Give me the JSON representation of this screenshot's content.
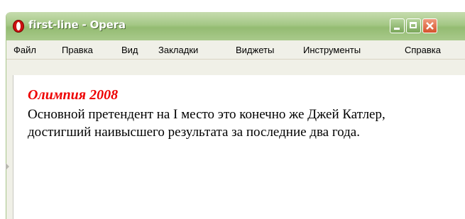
{
  "window": {
    "title": "first-line - Opera",
    "app_icon": "opera-logo-icon",
    "controls": [
      "minimize-icon",
      "maximize-icon",
      "close-icon"
    ],
    "colors": {
      "titlebar": "#a4c785",
      "close": "#d4532c"
    }
  },
  "menu": {
    "items": [
      {
        "label": "Файл"
      },
      {
        "label": "Правка"
      },
      {
        "label": "Вид"
      },
      {
        "label": "Закладки"
      },
      {
        "label": "Виджеты"
      },
      {
        "label": "Инструменты"
      },
      {
        "label": "Справка"
      }
    ]
  },
  "document": {
    "heading": "Олимпия 2008",
    "heading_color": "#ee0000",
    "paragraph": "Основной претендент на I место это конечно же Джей Катлер, достигший наивысшего результата за последние два года."
  }
}
